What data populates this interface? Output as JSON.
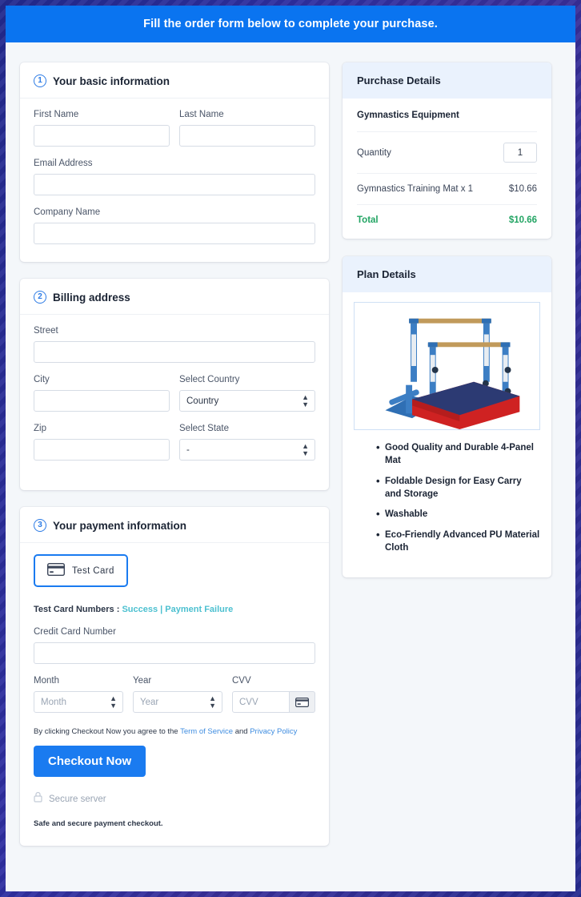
{
  "banner": {
    "text": "Fill the order form below to complete your purchase."
  },
  "sections": {
    "basic": {
      "step": "1",
      "title": "Your basic information",
      "fields": {
        "first_name_label": "First Name",
        "first_name_value": "",
        "last_name_label": "Last Name",
        "last_name_value": "",
        "email_label": "Email Address",
        "email_value": "",
        "company_label": "Company Name",
        "company_value": ""
      }
    },
    "billing": {
      "step": "2",
      "title": "Billing address",
      "fields": {
        "street_label": "Street",
        "street_value": "",
        "city_label": "City",
        "city_value": "",
        "country_label": "Select Country",
        "country_value": "Country",
        "zip_label": "Zip",
        "zip_value": "",
        "state_label": "Select State",
        "state_value": "-"
      }
    },
    "payment": {
      "step": "3",
      "title": "Your payment information",
      "test_card_button": "Test  Card",
      "test_numbers_label": "Test Card Numbers :",
      "test_success_link": "Success",
      "test_separator": "|",
      "test_failure_link": "Payment Failure",
      "card_number_label": "Credit Card Number",
      "card_number_value": "",
      "month_label": "Month",
      "month_placeholder": "Month",
      "year_label": "Year",
      "year_placeholder": "Year",
      "cvv_label": "CVV",
      "cvv_placeholder": "CVV",
      "terms_prefix": "By clicking Checkout Now you agree to the",
      "terms_link": "Term of Service",
      "terms_and": "and",
      "privacy_link": "Privacy Policy",
      "checkout_button": "Checkout Now",
      "secure_server": "Secure server",
      "safe_note": "Safe and secure payment checkout."
    }
  },
  "purchase": {
    "title": "Purchase Details",
    "product_category": "Gymnastics Equipment",
    "quantity_label": "Quantity",
    "quantity_value": "1",
    "line_item_label": "Gymnastics Training Mat x 1",
    "line_item_price": "$10.66",
    "total_label": "Total",
    "total_price": "$10.66"
  },
  "plan": {
    "title": "Plan Details",
    "features": [
      "Good Quality and Durable 4-Panel Mat",
      "Foldable Design for Easy Carry and Storage",
      "Washable",
      "Eco-Friendly Advanced PU Material Cloth"
    ]
  },
  "colors": {
    "banner_blue": "#0a74f0",
    "accent_blue": "#1a7bf0",
    "link_teal": "#4cc0d0",
    "total_green": "#22a463",
    "panel_head_blue": "#eaf2fd"
  }
}
